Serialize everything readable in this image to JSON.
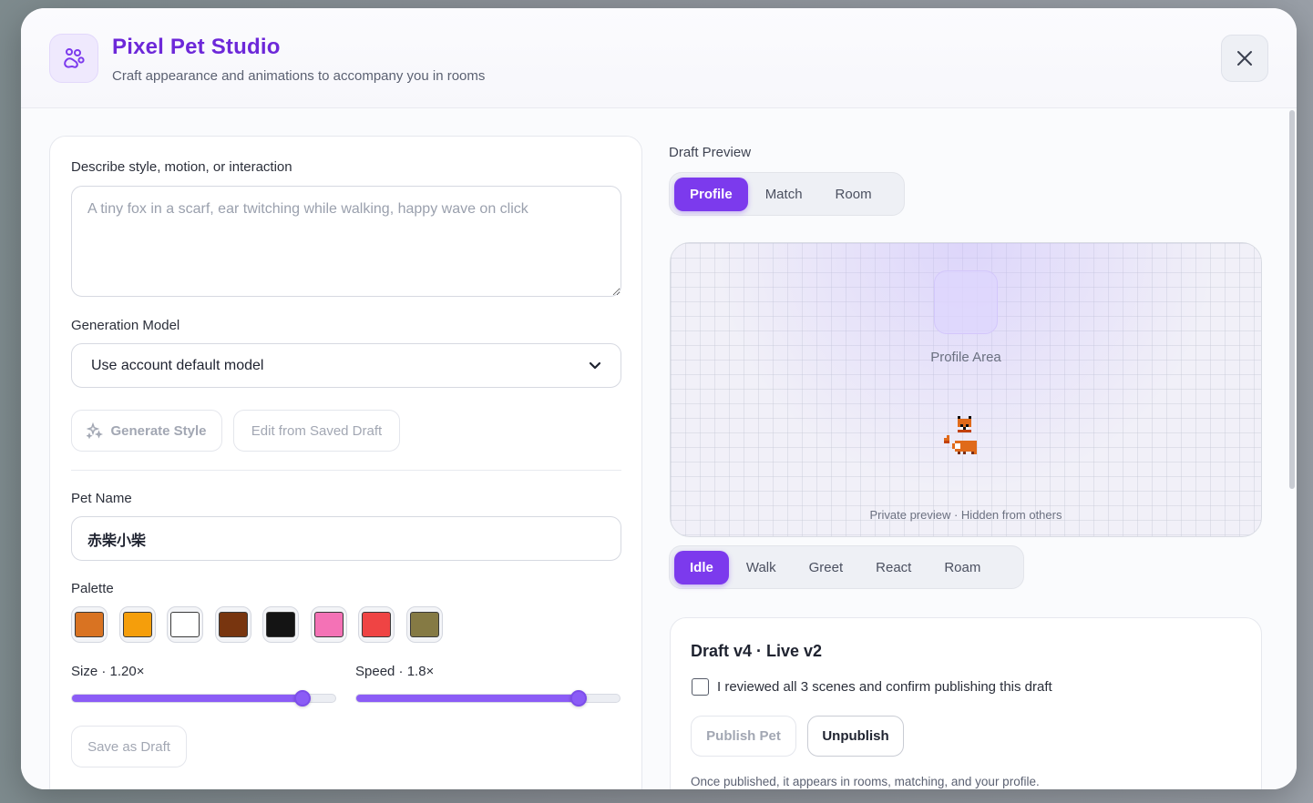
{
  "header": {
    "title": "Pixel Pet Studio",
    "subtitle": "Craft appearance and animations to accompany you in rooms",
    "close_label": "×"
  },
  "left": {
    "describe_label": "Describe style, motion, or interaction",
    "describe_placeholder": "A tiny fox in a scarf, ear twitching while walking, happy wave on click",
    "describe_value": "",
    "model_label": "Generation Model",
    "model_selected": "Use account default model",
    "generate_label": "Generate Style",
    "edit_label": "Edit from Saved Draft",
    "pet_name_label": "Pet Name",
    "pet_name_value": "赤柴小柴",
    "palette_label": "Palette",
    "palette": [
      "#d97322",
      "#f59e0b",
      "#ffffff",
      "#78350f",
      "#141414",
      "#f472b6",
      "#ef4444",
      "#857a44"
    ],
    "size_label": "Size · 1.20×",
    "size_fraction": 0.875,
    "speed_label": "Speed · 1.8×",
    "speed_fraction": 0.843,
    "save_draft_label": "Save as Draft"
  },
  "right": {
    "preview_title": "Draft Preview",
    "view_tabs": [
      {
        "label": "Profile",
        "active": true
      },
      {
        "label": "Match",
        "active": false
      },
      {
        "label": "Room",
        "active": false
      }
    ],
    "profile_area_label": "Profile Area",
    "private_label": "Private preview · Hidden from others",
    "anim_tabs": [
      {
        "label": "Idle",
        "active": true
      },
      {
        "label": "Walk",
        "active": false
      },
      {
        "label": "Greet",
        "active": false
      },
      {
        "label": "React",
        "active": false
      },
      {
        "label": "Roam",
        "active": false
      }
    ],
    "draft_title": "Draft v4 · Live v2",
    "confirm_label": "I reviewed all 3 scenes and confirm publishing this draft",
    "publish_label": "Publish Pet",
    "unpublish_label": "Unpublish",
    "publish_note": "Once published, it appears in rooms, matching, and your profile."
  },
  "colors": {
    "accent": "#7c3aed",
    "title": "#6d28d9"
  }
}
